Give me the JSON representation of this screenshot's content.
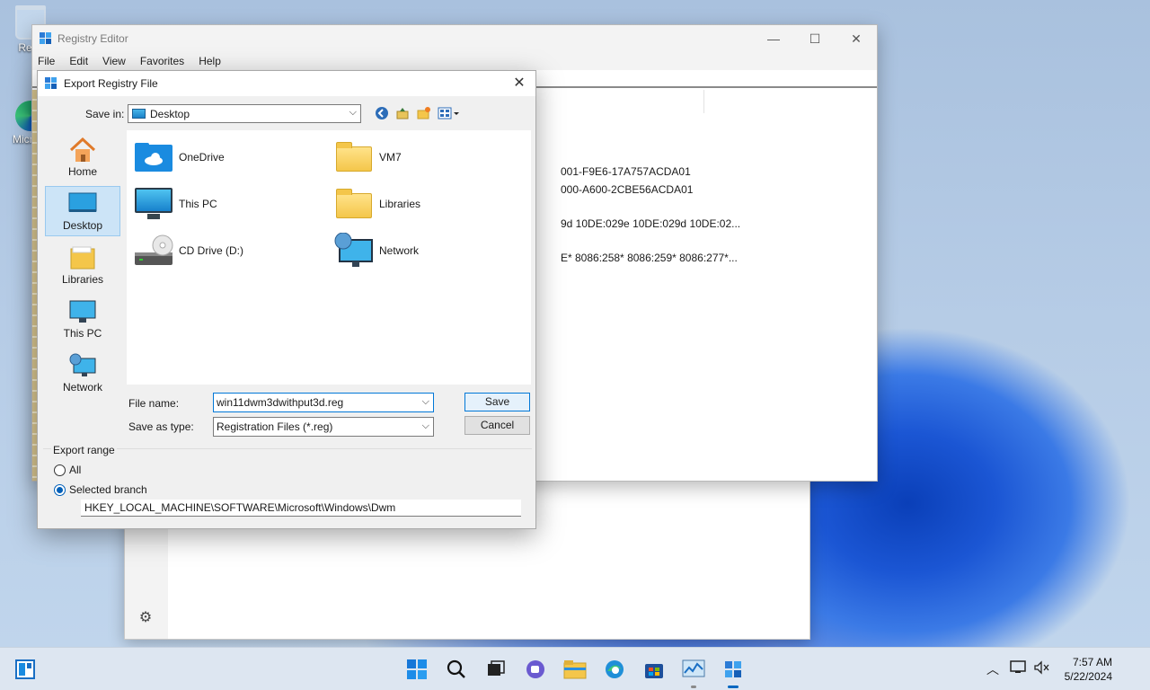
{
  "desktop": {
    "icons": [
      {
        "label": "Recy"
      },
      {
        "label": "Micr Ec"
      }
    ]
  },
  "regedit": {
    "title": "Registry Editor",
    "menu": [
      "File",
      "Edit",
      "View",
      "Favorites",
      "Help"
    ],
    "rows": [
      "001-F9E6-17A757ACDA01",
      "000-A600-2CBE56ACDA01",
      "9d 10DE:029e 10DE:029d 10DE:02...",
      "E* 8086:258* 8086:259* 8086:277*..."
    ],
    "window_controls": {
      "minimize": "—",
      "maximize": "☐",
      "close": "✕"
    }
  },
  "dialog": {
    "title": "Export Registry File",
    "close": "✕",
    "save_in_label": "Save in:",
    "save_in_value": "Desktop",
    "places": [
      {
        "label": "Home",
        "icon": "home-icon"
      },
      {
        "label": "Desktop",
        "icon": "desktop-icon",
        "selected": true
      },
      {
        "label": "Libraries",
        "icon": "libraries-icon"
      },
      {
        "label": "This PC",
        "icon": "this-pc-icon"
      },
      {
        "label": "Network",
        "icon": "network-icon"
      }
    ],
    "files": [
      {
        "label": "OneDrive",
        "icon": "onedrive-folder-icon"
      },
      {
        "label": "VM7",
        "icon": "folder-icon"
      },
      {
        "label": "This PC",
        "icon": "this-pc-icon"
      },
      {
        "label": "Libraries",
        "icon": "libraries-icon"
      },
      {
        "label": "CD Drive (D:)",
        "icon": "cd-drive-icon"
      },
      {
        "label": "Network",
        "icon": "network-icon"
      }
    ],
    "file_name_label": "File name:",
    "file_name_value": "win11dwm3dwithput3d.reg",
    "save_as_type_label": "Save as type:",
    "save_as_type_value": "Registration Files (*.reg)",
    "save_button": "Save",
    "cancel_button": "Cancel",
    "export_range": {
      "legend": "Export range",
      "all_label": "All",
      "selected_branch_label": "Selected branch",
      "selected": "Selected branch",
      "branch_path": "HKEY_LOCAL_MACHINE\\SOFTWARE\\Microsoft\\Windows\\Dwm"
    }
  },
  "taskbar": {
    "clock_time": "7:57 AM",
    "clock_date": "5/22/2024",
    "items": [
      "widgets",
      "start",
      "search",
      "task-view",
      "chat",
      "file-explorer",
      "edge",
      "store",
      "task-manager",
      "registry-editor"
    ]
  },
  "colors": {
    "accent": "#0078d7",
    "selection": "#cce4f7",
    "taskbar": "#dde6f1"
  }
}
